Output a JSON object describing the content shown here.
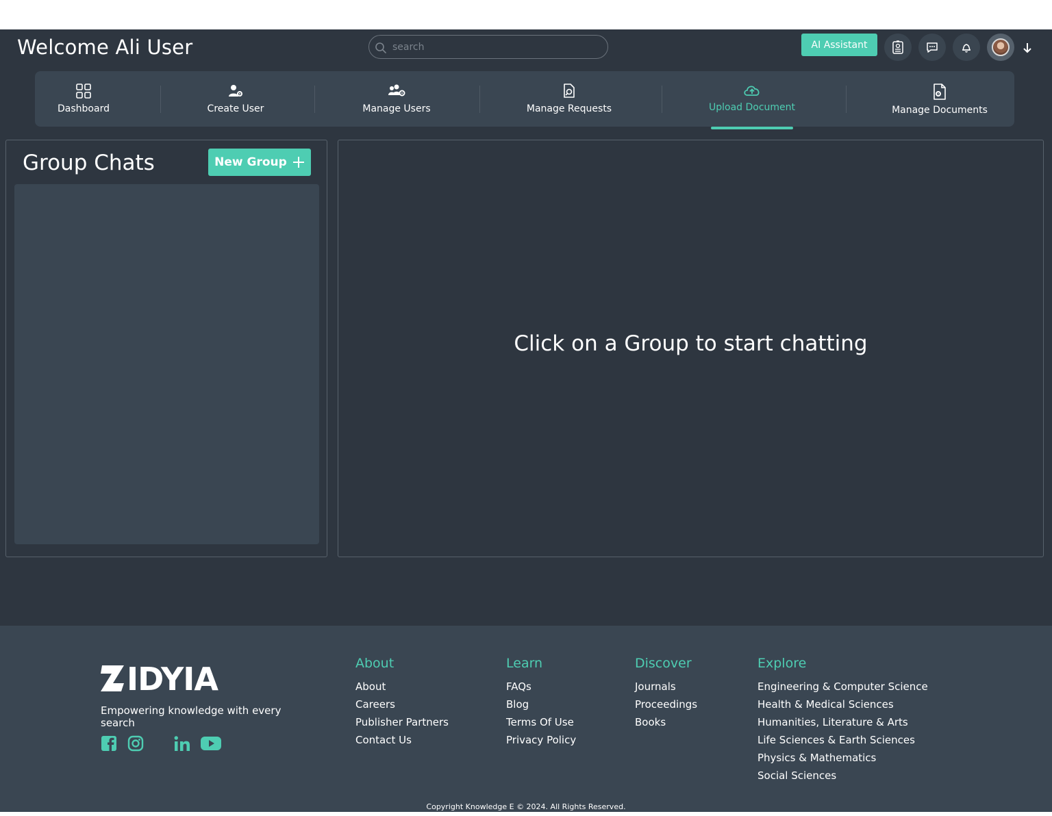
{
  "header": {
    "welcome": "Welcome Ali User",
    "search_placeholder": "search",
    "ai_button": "AI Assistant"
  },
  "nav": {
    "items": [
      {
        "label": "Dashboard",
        "icon": "grid-icon"
      },
      {
        "label": "Create User",
        "icon": "user-gear-icon"
      },
      {
        "label": "Manage Users",
        "icon": "users-gear-icon"
      },
      {
        "label": "Manage Requests",
        "icon": "document-search-icon"
      },
      {
        "label": "Upload Document",
        "icon": "cloud-upload-icon",
        "active": true
      },
      {
        "label": "Manage Documents",
        "icon": "document-gear-icon"
      }
    ]
  },
  "chats": {
    "title": "Group Chats",
    "new_group": "New Group",
    "empty_message": "Click on a Group to start chatting"
  },
  "footer": {
    "brand": "ZIDYIA",
    "tagline": "Empowering knowledge with every search",
    "columns": [
      {
        "title": "About",
        "links": [
          "About",
          "Careers",
          "Publisher Partners",
          "Contact Us"
        ]
      },
      {
        "title": "Learn",
        "links": [
          "FAQs",
          "Blog",
          "Terms Of Use",
          "Privacy Policy"
        ]
      },
      {
        "title": "Discover",
        "links": [
          "Journals",
          "Proceedings",
          "Books"
        ]
      },
      {
        "title": "Explore",
        "links": [
          "Engineering & Computer Science",
          "Health & Medical Sciences",
          "Humanities, Literature & Arts",
          "Life Sciences & Earth Sciences",
          "Physics & Mathematics",
          "Social Sciences"
        ]
      }
    ],
    "copyright": "Copyright Knowledge E © 2024. All Rights Reserved."
  },
  "colors": {
    "accent": "#4ecdb2",
    "background": "#2e3640",
    "panel": "#3a4652"
  }
}
